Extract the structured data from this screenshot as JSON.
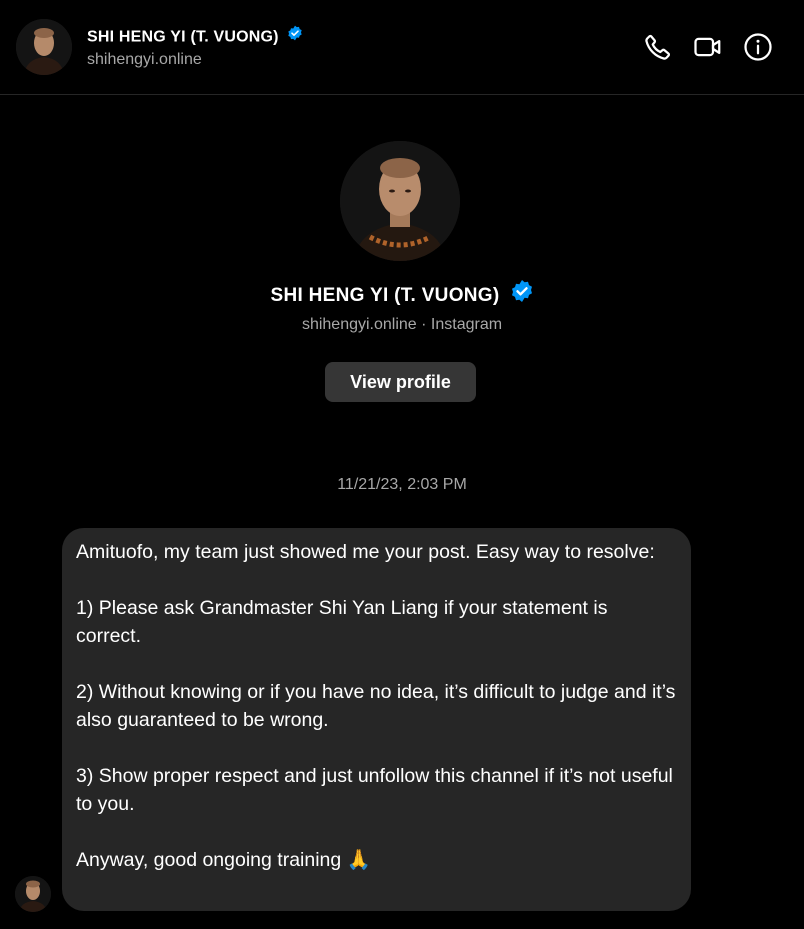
{
  "header": {
    "name": "SHI HENG YI (T. VUONG)",
    "subtitle": "shihengyi.online",
    "actions": [
      "phone-icon",
      "video-icon",
      "info-icon"
    ]
  },
  "profile": {
    "name": "SHI HENG YI (T. VUONG)",
    "subtitle": "shihengyi.online · Instagram",
    "view_profile_label": "View profile"
  },
  "conversation": {
    "timestamp": "11/21/23, 2:03 PM",
    "message": {
      "paragraphs": [
        "Amituofo, my team just showed me your post. Easy way to resolve:",
        "1) Please ask Grandmaster Shi Yan Liang if your statement is correct.",
        "2) Without knowing or if you have no idea, it’s difficult to judge and it’s also guaranteed to be wrong.",
        "3) Show proper respect and just unfollow this channel if it’s not useful to you.",
        "Anyway, good ongoing training 🙏"
      ]
    }
  },
  "colors": {
    "background": "#000000",
    "bubble": "#262626",
    "button": "#363636",
    "secondary_text": "#a8a8a8",
    "verified": "#0095f6"
  }
}
